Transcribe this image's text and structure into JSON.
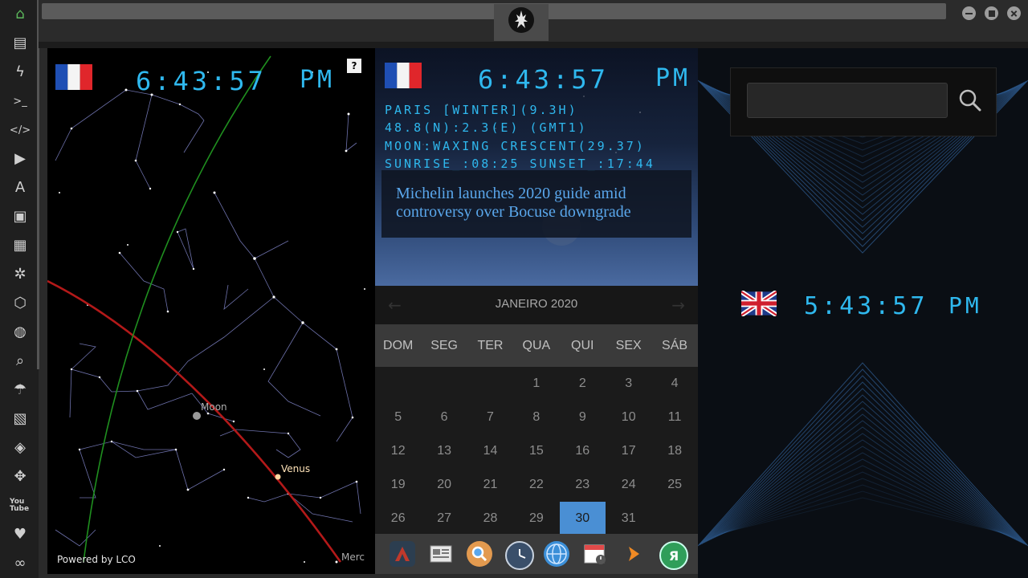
{
  "sidebar": {
    "items": [
      {
        "name": "home-icon"
      },
      {
        "name": "document-icon"
      },
      {
        "name": "lightning-icon"
      },
      {
        "name": "terminal-icon"
      },
      {
        "name": "code-icon"
      },
      {
        "name": "play-icon"
      },
      {
        "name": "translate-icon"
      },
      {
        "name": "image-icon"
      },
      {
        "name": "news-icon"
      },
      {
        "name": "settings-icon"
      },
      {
        "name": "hexagon-icon"
      },
      {
        "name": "globe-icon"
      },
      {
        "name": "search-icon"
      },
      {
        "name": "umbrella-icon"
      },
      {
        "name": "contact-icon"
      },
      {
        "name": "link-icon"
      },
      {
        "name": "fullscreen-icon"
      },
      {
        "name": "youtube-icon"
      },
      {
        "name": "heart-icon"
      },
      {
        "name": "cloud-icon"
      }
    ],
    "youtube_label": "You Tube"
  },
  "star_map": {
    "time": "6:43:57",
    "ampm": "PM",
    "help_label": "?",
    "labels": {
      "moon": "Moon",
      "venus": "Venus",
      "mercury": "Merc"
    },
    "powered_by": "Powered by LCO"
  },
  "paris": {
    "time": "6:43:57",
    "ampm": "PM",
    "info": [
      "PARIS [WINTER](9.3H)",
      "48.8(N):2.3(E) (GMT1)",
      "MOON:WAXING CRESCENT(29.37)",
      "SUNRISE_:08:25 SUNSET_:17:44"
    ],
    "news": "Michelin launches 2020 guide amid controversy over Bocuse downgrade"
  },
  "calendar": {
    "title": "JANEIRO 2020",
    "prev": "←",
    "next": "→",
    "days": [
      "DOM",
      "SEG",
      "TER",
      "QUA",
      "QUI",
      "SEX",
      "SÁB"
    ],
    "weeks": [
      [
        "",
        "",
        "",
        "1",
        "2",
        "3",
        "4"
      ],
      [
        "5",
        "6",
        "7",
        "8",
        "9",
        "10",
        "11"
      ],
      [
        "12",
        "13",
        "14",
        "15",
        "16",
        "17",
        "18"
      ],
      [
        "19",
        "20",
        "21",
        "22",
        "23",
        "24",
        "25"
      ],
      [
        "26",
        "27",
        "28",
        "29",
        "30",
        "31",
        ""
      ]
    ],
    "today": "30"
  },
  "dock": {
    "items": [
      {
        "name": "app-a-icon",
        "color": "#c0392b"
      },
      {
        "name": "newspaper-icon",
        "color": "#e8e8e8"
      },
      {
        "name": "search-app-icon",
        "color": "#e39a4f"
      },
      {
        "name": "clock-icon",
        "color": "#3a4f6a"
      },
      {
        "name": "globe-app-icon",
        "color": "#3b8fd8"
      },
      {
        "name": "calendar-app-icon",
        "color": "#e14a4a"
      },
      {
        "name": "play-arrow-icon",
        "color": "#f08a24"
      },
      {
        "name": "yandex-icon",
        "color": "#2f9e5a",
        "text": "Я"
      }
    ]
  },
  "london": {
    "time": "5:43:57",
    "ampm": "PM"
  },
  "search": {
    "placeholder": "",
    "value": ""
  }
}
